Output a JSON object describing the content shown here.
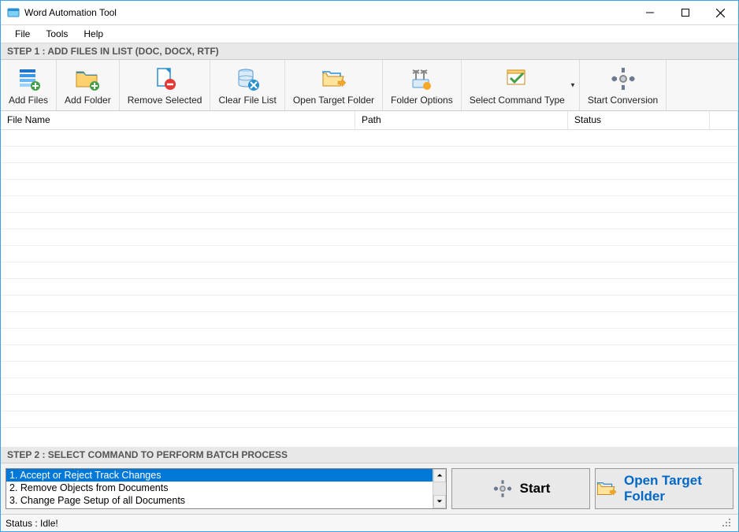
{
  "window": {
    "title": "Word Automation Tool"
  },
  "menu": {
    "file": "File",
    "tools": "Tools",
    "help": "Help"
  },
  "step1": {
    "header": "STEP 1 : ADD FILES IN LIST (DOC, DOCX, RTF)"
  },
  "toolbar": {
    "add_files": "Add Files",
    "add_folder": "Add Folder",
    "remove_selected": "Remove Selected",
    "clear_list": "Clear File List",
    "open_target": "Open Target Folder",
    "folder_options": "Folder Options",
    "select_command": "Select Command Type",
    "start_conversion": "Start Conversion"
  },
  "table": {
    "columns": {
      "filename": "File Name",
      "path": "Path",
      "status": "Status"
    }
  },
  "step2": {
    "header": "STEP 2 : SELECT COMMAND TO PERFORM BATCH PROCESS",
    "commands": [
      "1. Accept or Reject Track Changes",
      "2. Remove Objects from Documents",
      "3. Change Page Setup of all Documents"
    ],
    "start": "Start",
    "open_target": "Open Target Folder"
  },
  "status": {
    "text": "Status  :  Idle!"
  }
}
